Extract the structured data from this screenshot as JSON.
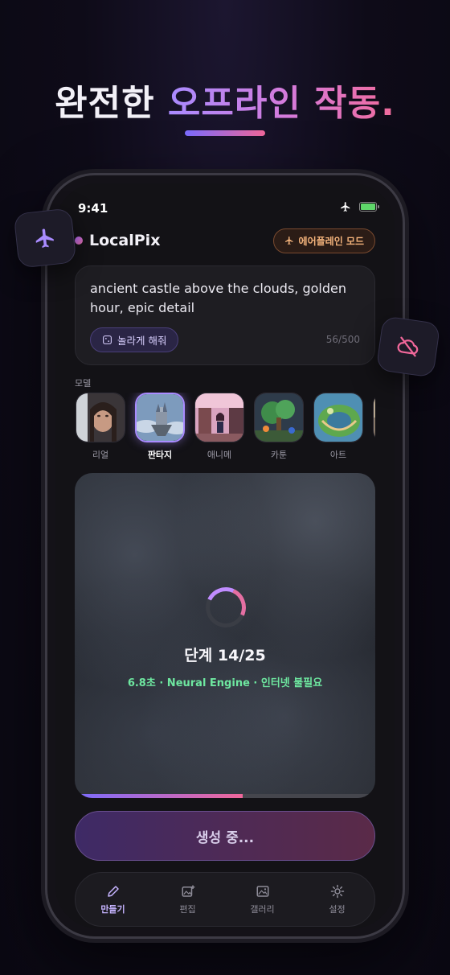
{
  "headline": {
    "part1": "완전한 ",
    "part2": "오프라인 작동."
  },
  "status_bar": {
    "time": "9:41"
  },
  "app": {
    "name": "LocalPix",
    "mode_pill": "에어플레인 모드"
  },
  "prompt": {
    "text": "ancient castle above the clouds, golden hour, epic detail",
    "surprise_label": "놀라게 해줘",
    "char_count": "56/500"
  },
  "models": {
    "label": "모델",
    "items": [
      {
        "name": "리얼",
        "selected": false
      },
      {
        "name": "판타지",
        "selected": true
      },
      {
        "name": "애니메",
        "selected": false
      },
      {
        "name": "카툰",
        "selected": false
      },
      {
        "name": "아트",
        "selected": false
      }
    ]
  },
  "generation": {
    "step_text": "단계 14/25",
    "meta_text": "6.8초 · Neural Engine · 인터넷 불필요",
    "progress": 0.56
  },
  "generate_button": "생성 중...",
  "tabs": [
    {
      "label": "만들기",
      "icon": "pencil-icon",
      "active": true
    },
    {
      "label": "편집",
      "icon": "image-plus-icon",
      "active": false
    },
    {
      "label": "갤러리",
      "icon": "gallery-icon",
      "active": false
    },
    {
      "label": "설정",
      "icon": "gear-icon",
      "active": false
    }
  ],
  "colors": {
    "accent_purple": "#a98bff",
    "accent_pink": "#f0679a",
    "success_green": "#6ee7a0",
    "airplane_orange": "#f2b27b"
  }
}
